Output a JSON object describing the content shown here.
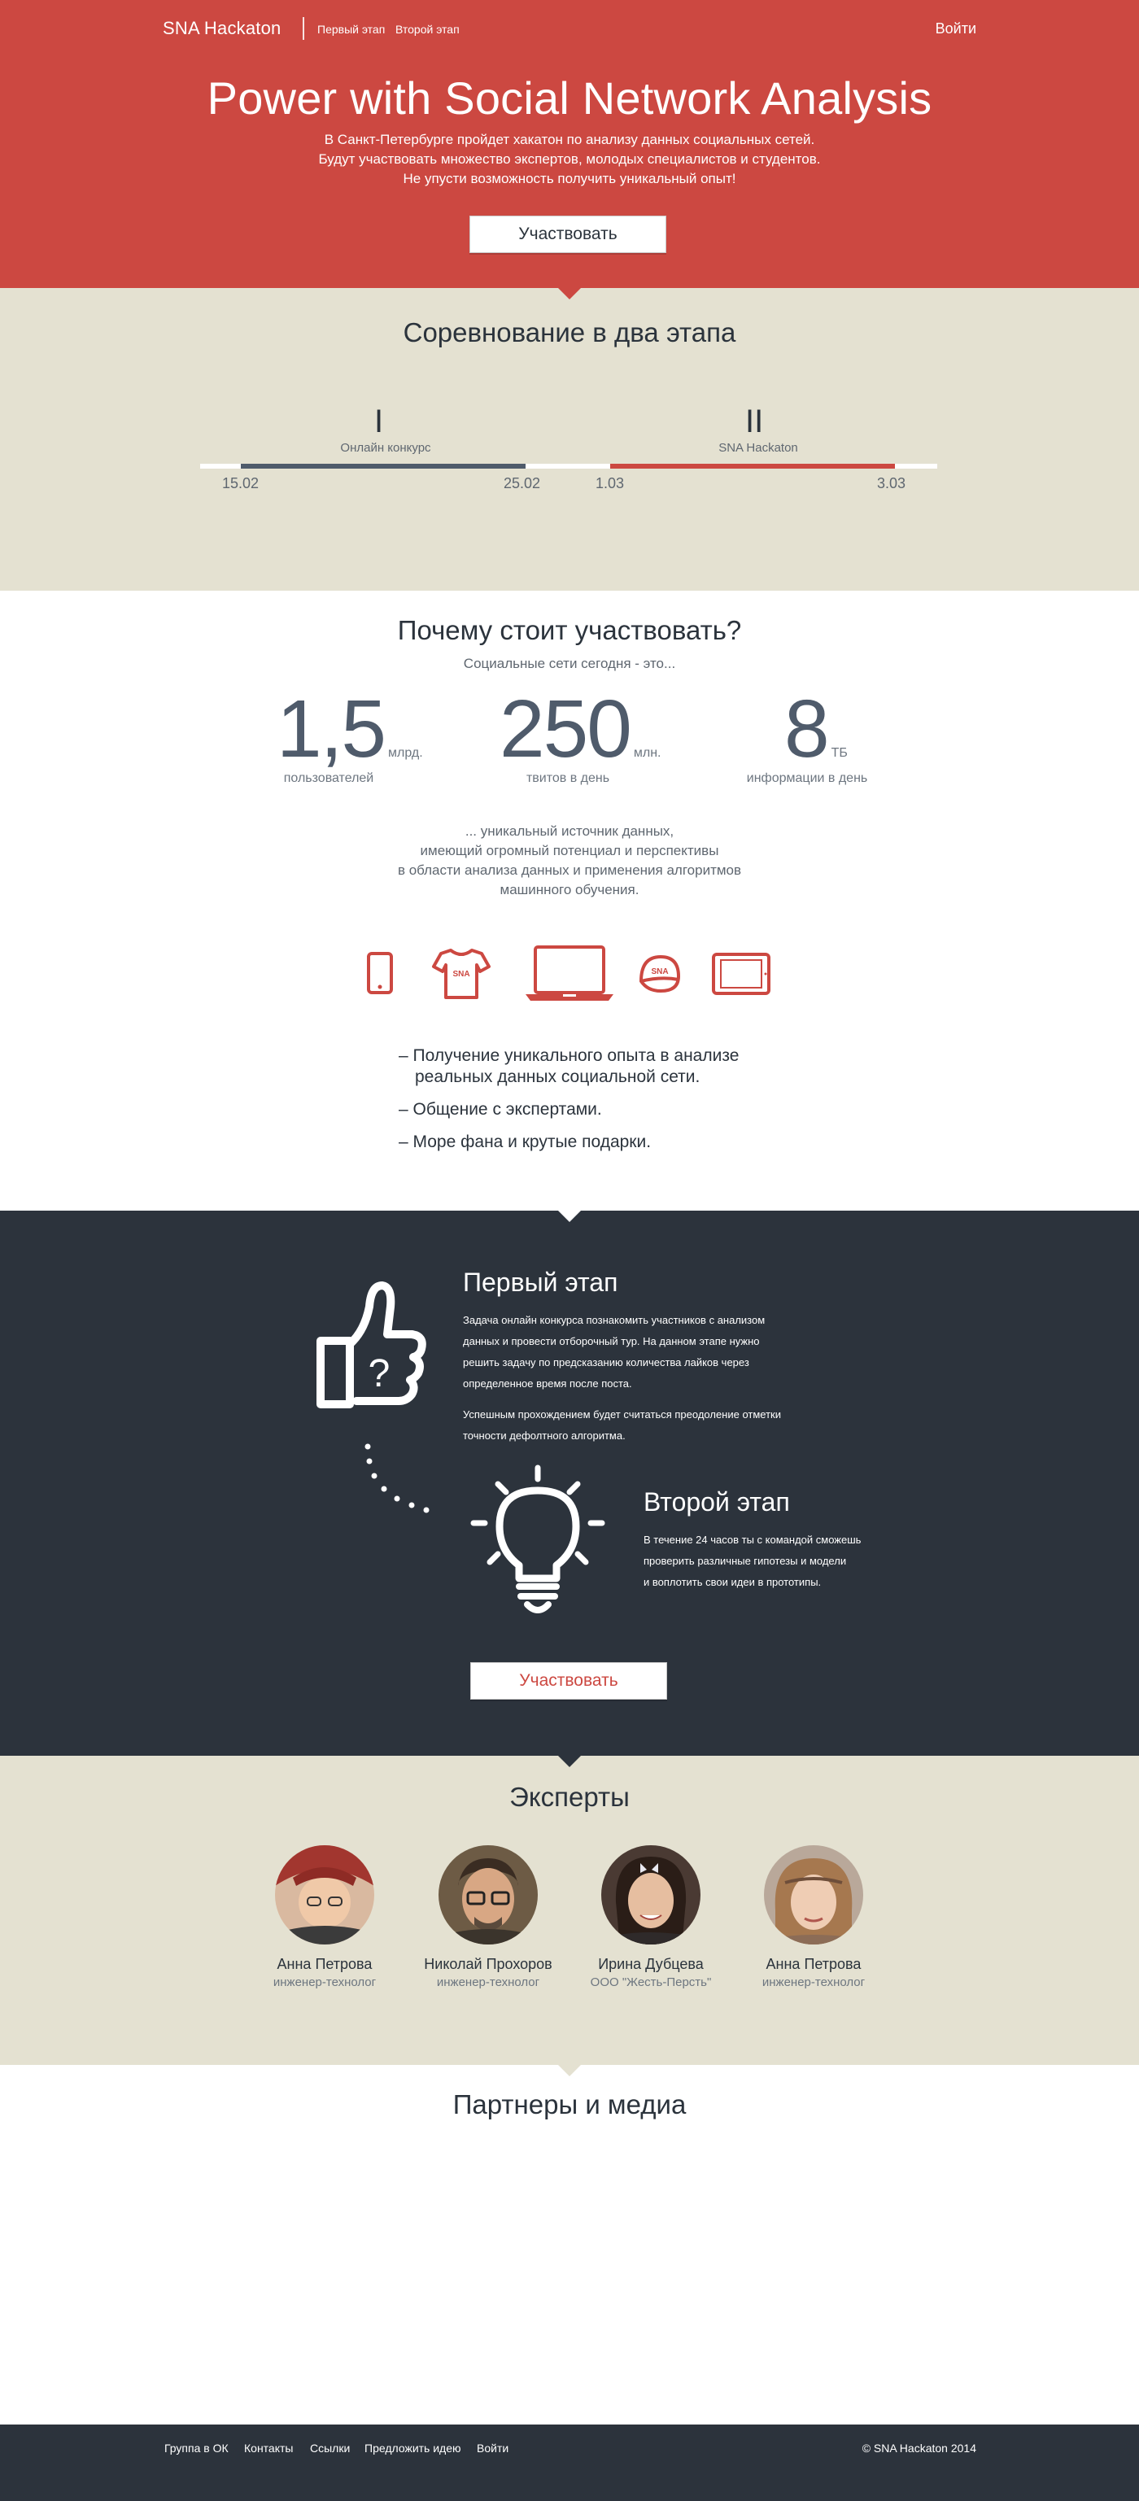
{
  "nav": {
    "brand": "SNA Hackaton",
    "links": [
      "Первый этап",
      "Второй этап"
    ],
    "login": "Войти"
  },
  "hero": {
    "title": "Power with Social Network Analysis",
    "lines": [
      "В Санкт-Петербурге пройдет хакатон по анализу данных социальных сетей.",
      "Будут участвовать множество экспертов, молодых специалистов и студентов.",
      "Не упусти возможность получить уникальный опыт!"
    ],
    "cta": "Участвовать"
  },
  "stages": {
    "title": "Соревнование в два этапа",
    "items": [
      {
        "roman": "I",
        "label": "Онлайн конкурс",
        "start": "15.02",
        "end": "25.02"
      },
      {
        "roman": "II",
        "label": "SNA Hackaton",
        "start": "1.03",
        "end": "3.03"
      }
    ]
  },
  "why": {
    "title": "Почему стоит участвовать?",
    "subtitle": "Социальные сети сегодня - это...",
    "stats": [
      {
        "value": "1,5",
        "unit": "млрд.",
        "caption": "пользователей"
      },
      {
        "value": "250",
        "unit": "млн.",
        "caption": "твитов в день"
      },
      {
        "value": "8",
        "unit": "ТБ",
        "caption": "информации в день"
      }
    ],
    "lines": [
      "... уникальный источник данных,",
      "имеющий огромный потенциал и перспективы",
      "в области анализа данных и применения алгоритмов",
      "машинного обучения."
    ],
    "icons": [
      "phone-icon",
      "tshirt-icon",
      "laptop-icon",
      "cap-icon",
      "tablet-icon"
    ],
    "icon_text": "SNA",
    "benefits": [
      "– Получение уникального опыта в анализе",
      "реальных данных социальной сети.",
      "– Общение с экспертами.",
      "– Море фана и крутые подарки."
    ]
  },
  "process": {
    "stage1": {
      "title": "Первый этап",
      "p1": [
        "Задача онлайн конкурса познакомить участников с анализом",
        "данных и провести отборочный тур. На данном этапе нужно",
        "решить задачу по предсказанию количества лайков через",
        "определенное время после поста."
      ],
      "p2": [
        "Успешным прохождением будет считаться преодоление отметки",
        "точности дефолтного алгоритма."
      ]
    },
    "stage2": {
      "title": "Второй этап",
      "p": [
        "В течение 24 часов ты с командой сможешь",
        "проверить различные гипотезы и модели",
        "и воплотить свои идеи в прототипы."
      ]
    },
    "cta": "Участвовать",
    "colors": {
      "accent": "#cc4841",
      "dark": "#2c333c",
      "beige": "#e4e1d1"
    }
  },
  "experts": {
    "title": "Эксперты",
    "people": [
      {
        "name": "Анна Петрова",
        "role": "инженер-технолог"
      },
      {
        "name": "Николай Прохоров",
        "role": "инженер-технолог"
      },
      {
        "name": "Ирина Дубцева",
        "role": "ООО \"Жесть-Персть\""
      },
      {
        "name": "Анна Петрова",
        "role": "инженер-технолог"
      }
    ]
  },
  "partners": {
    "title": "Партнеры и медиа"
  },
  "footer": {
    "links": [
      "Группа в ОК",
      "Контакты",
      "Ссылки",
      "Предложить идею",
      "Войти"
    ],
    "copyright": "© SNA Hackaton 2014"
  }
}
